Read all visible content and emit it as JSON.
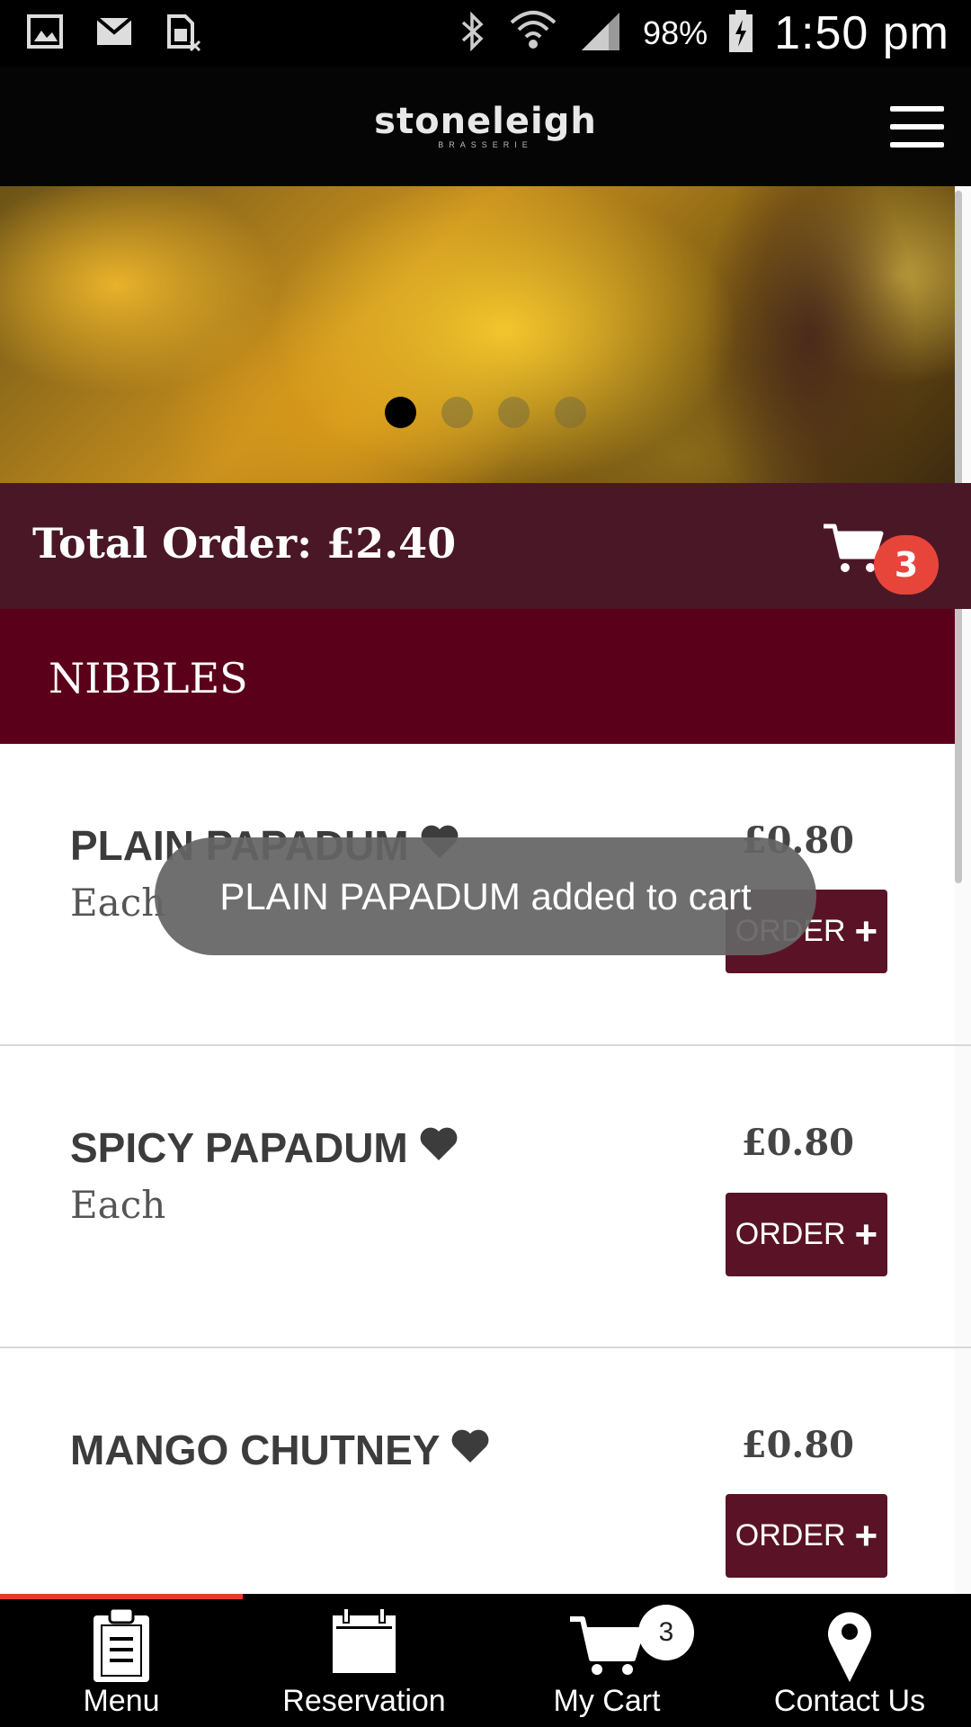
{
  "status_bar": {
    "battery_percent": "98%",
    "time": "1:50 pm",
    "left_icons": [
      "gallery-icon",
      "gmail-icon",
      "sim-icon"
    ],
    "right_icons": [
      "bluetooth-icon",
      "wifi-icon",
      "signal-icon",
      "battery-charging-icon"
    ]
  },
  "header": {
    "logo_text": "stoneleigh",
    "logo_subtext": "BRASSERIE",
    "menu_icon": "hamburger-icon"
  },
  "carousel": {
    "slide_count": 4,
    "active_index": 0
  },
  "order_summary": {
    "total_label": "Total Order: £2.40",
    "cart_count": "3",
    "cart_icon": "cart-icon"
  },
  "category": {
    "title": "NIBBLES"
  },
  "items": [
    {
      "name": "PLAIN PAPADUM",
      "unit": "Each",
      "price": "£0.80",
      "order_label": "ORDER"
    },
    {
      "name": "SPICY PAPADUM",
      "unit": "Each",
      "price": "£0.80",
      "order_label": "ORDER"
    },
    {
      "name": "MANGO CHUTNEY",
      "unit": "",
      "price": "£0.80",
      "order_label": "ORDER"
    }
  ],
  "toast": {
    "message": "PLAIN PAPADUM added to cart"
  },
  "bottom_nav": {
    "active_index": 0,
    "items": [
      {
        "label": "Menu",
        "icon": "clipboard-icon"
      },
      {
        "label": "Reservation",
        "icon": "calendar-icon"
      },
      {
        "label": "My Cart",
        "icon": "cart-icon",
        "badge": "3"
      },
      {
        "label": "Contact Us",
        "icon": "location-pin-icon"
      }
    ]
  },
  "colors": {
    "header_bg": "#050505",
    "total_bar_bg": "#4a1726",
    "category_bg": "#5b001a",
    "order_button_bg": "#5a1326",
    "badge_red": "#e8453a",
    "nav_indicator": "#e63a35"
  }
}
